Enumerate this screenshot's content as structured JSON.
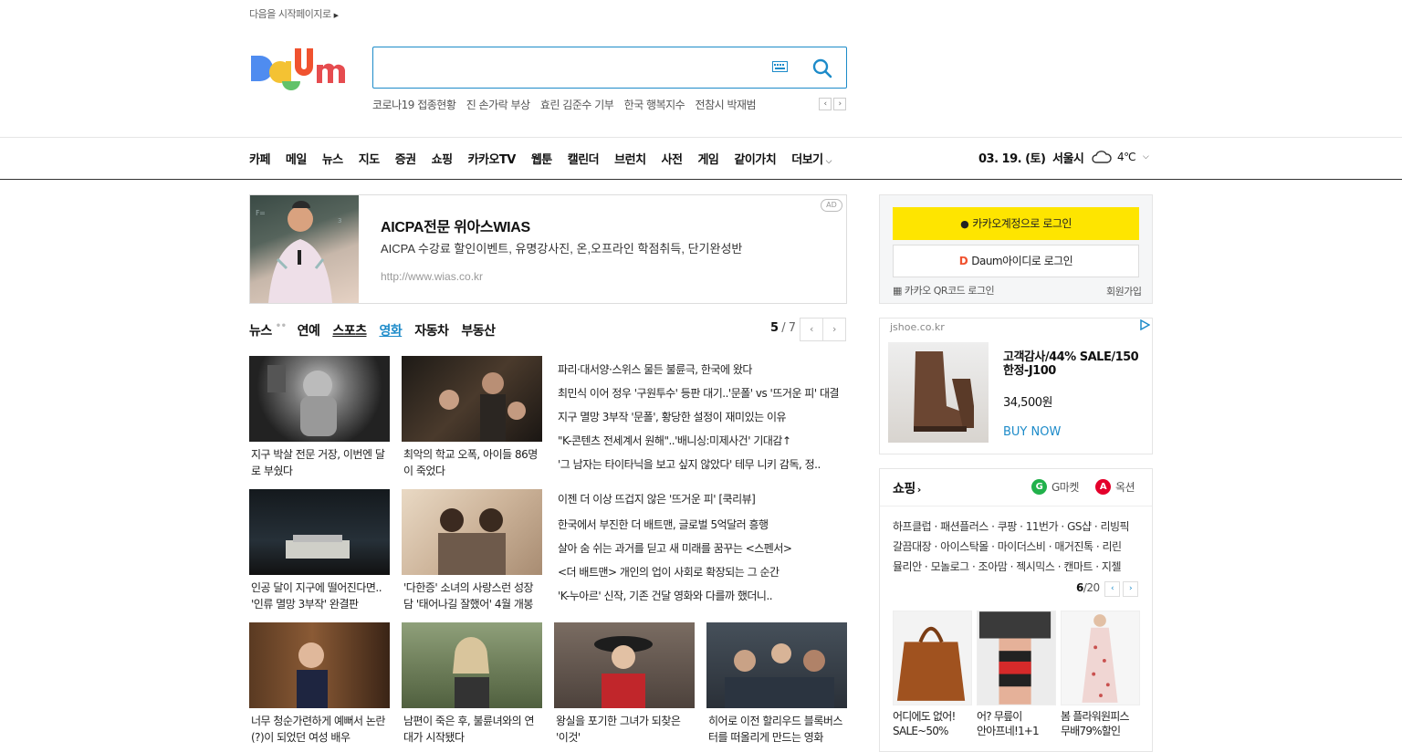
{
  "top": {
    "start_page": "다음을 시작페이지로"
  },
  "search": {
    "placeholder": ""
  },
  "issues": [
    "코로나19 접종현황",
    "진 손가락 부상",
    "효린 김준수 기부",
    "한국 행복지수",
    "전참시 박재범"
  ],
  "gnb": [
    "카페",
    "메일",
    "뉴스",
    "지도",
    "증권",
    "쇼핑",
    "카카오TV",
    "웹툰",
    "캘린더",
    "브런치",
    "사전",
    "게임",
    "같이가치",
    "더보기"
  ],
  "weather": {
    "date": "03. 19. (토)",
    "city": "서울시",
    "temp": "4℃"
  },
  "ad": {
    "badge": "AD",
    "title": "AICPA전문 위아스WIAS",
    "desc": "AICPA 수강료 할인이벤트, 유명강사진, 온,오프라인 학점취득, 단기완성반",
    "url": "http://www.wias.co.kr"
  },
  "tabs": [
    "뉴스",
    "연예",
    "스포츠",
    "영화",
    "자동차",
    "부동산"
  ],
  "paging": {
    "current": "5",
    "total": "/ 7"
  },
  "cards": [
    {
      "caption": "지구 박살 전문 거장, 이번엔 달로 부쉈다"
    },
    {
      "caption": "최악의 학교 오폭, 아이들 86명이 죽었다"
    },
    {
      "caption": "인공 달이 지구에 떨어진다면.. '인류 멸망 3부작' 완결판"
    },
    {
      "caption": "'다한증' 소녀의 사랑스런 성장담 '태어나길 잘했어' 4월 개봉"
    },
    {
      "caption": "너무 청순가련하게 예뻐서 논란(?)이 되었던 여성 배우"
    },
    {
      "caption": "남편이 죽은 후, 불륜녀와의 연대가 시작됐다"
    },
    {
      "caption": "왕실을 포기한 그녀가 되찾은 '이것'"
    },
    {
      "caption": "히어로 이전 할리우드 블록버스터를 떠올리게 만드는 영화"
    }
  ],
  "headlines": [
    "파리·대서양·스위스 물든 불륜극, 한국에 왔다",
    "최민식 이어 정우 '구원투수' 등판 대기..'문폴' vs '뜨거운 피' 대결",
    "지구 멸망 3부작 '문폴', 황당한 설정이 재미있는 이유",
    "\"K-콘텐츠 전세계서 원해\"..'배니싱:미제사건' 기대감↑",
    "'그 남자는 타이타닉을 보고 싶지 않았다' 테무 니키 감독, 정..",
    "이젠 더 이상 뜨겁지 않은 '뜨거운 피' [쿡리뷰]",
    "한국에서 부진한 더 배트맨, 글로벌 5억달러 흥행",
    "살아 숨 쉬는 과거를 딛고 새 미래를 꿈꾸는 <스펜서>",
    "<더 배트맨> 개인의 업이 사회로 확장되는 그 순간",
    "'K-누아르' 신작, 기존 건달 영화와 다를까 했더니.."
  ],
  "login": {
    "kakao": "카카오계정으로 로그인",
    "daum": "Daum아이디로 로그인",
    "qr": "카카오 QR코드 로그인",
    "join": "회원가입"
  },
  "ad2": {
    "domain": "jshoe.co.kr",
    "title": "고객감사/44% SALE/150한정-J100",
    "price": "34,500원",
    "buy": "BUY NOW"
  },
  "shopping": {
    "title": "쇼핑",
    "gmarket": "G마켓",
    "auction": "옥션",
    "rows": [
      "하프클럽 · 패션플러스 · 쿠팡 · 11번가 · GS샵 · 리빙픽",
      "갈끔대장 · 아이스탁몰 · 마이더스비 · 매거진톡 · 리린",
      "뮬리안 · 모놀로그 · 조아맘 · 젝시믹스 · 캔마트 · 지젤"
    ],
    "page": "6",
    "total": "/20",
    "products": [
      {
        "caption1": "어디에도 없어!",
        "caption2": "SALE~50%"
      },
      {
        "caption1": "어? 무릎이",
        "caption2": "안아프네!1+1"
      },
      {
        "caption1": "봄 플라워원피스",
        "caption2": "무배79%할인"
      }
    ]
  },
  "colors": {
    "accent": "#1d8bc9",
    "kakao": "#fee500"
  }
}
